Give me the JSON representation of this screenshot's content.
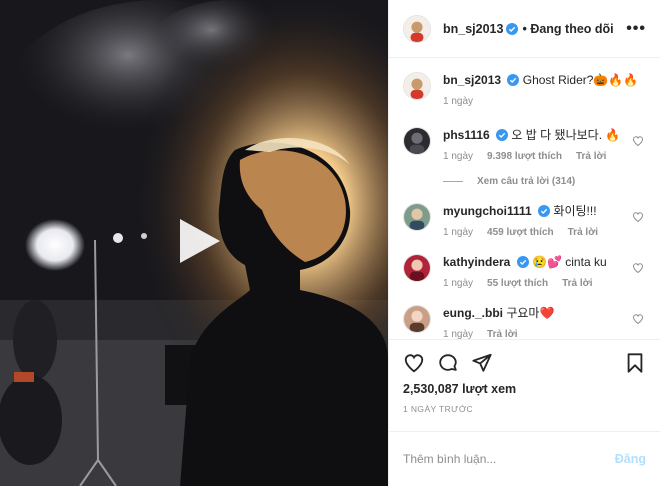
{
  "post_header": {
    "username": "bn_sj2013",
    "follow_text": "• Đang theo dõi",
    "more_icon": "more-dots-icon"
  },
  "caption": {
    "username": "bn_sj2013",
    "text": "Ghost Rider?🎃🔥🔥",
    "time": "1 ngày"
  },
  "comments": [
    {
      "username": "phs1116",
      "verified": true,
      "text": "오 밥 다 됐나보다. 🔥",
      "time": "1 ngày",
      "likes": "9.398 lượt thích",
      "reply": "Trả lời"
    },
    {
      "username": "myungchoi1111",
      "verified": true,
      "text": "화이팅!!!",
      "time": "1 ngày",
      "likes": "459 lượt thích",
      "reply": "Trả lời"
    },
    {
      "username": "kathyindera",
      "verified": true,
      "text": "😢💕 cinta ku",
      "time": "1 ngày",
      "likes": "55 lượt thích",
      "reply": "Trả lời"
    },
    {
      "username": "eung._.bbi",
      "verified": false,
      "text": "구요마❤️",
      "time": "1 ngày",
      "likes": "",
      "reply": "Trả lời"
    }
  ],
  "view_replies": "Xem câu trả lời (314)",
  "stats": {
    "views": "2,530,087 lượt xem",
    "posted": "1 NGÀY TRƯỚC"
  },
  "add_comment": {
    "placeholder": "Thêm bình luận...",
    "post_label": "Đăng"
  },
  "colors": {
    "verified": "#3897f0",
    "post_disabled": "#b2dffc",
    "meta": "#8e8e8e"
  }
}
